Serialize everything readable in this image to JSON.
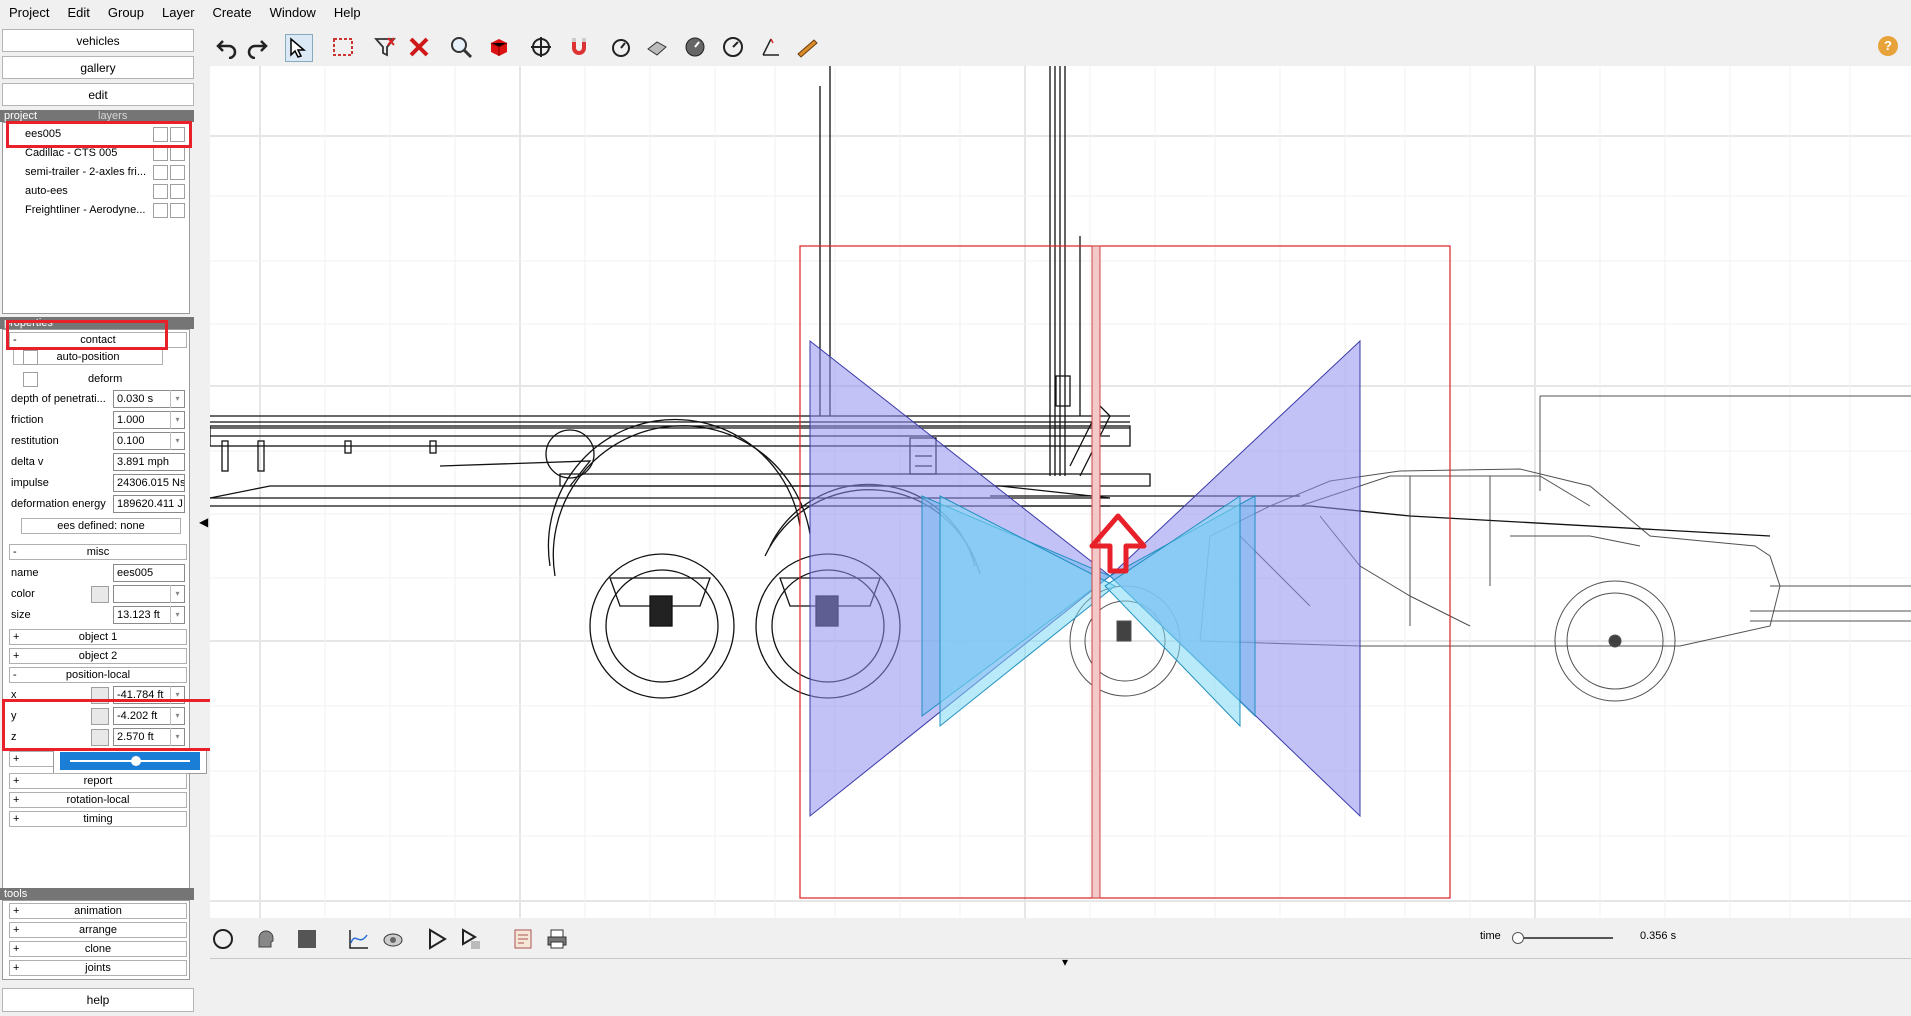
{
  "menu": [
    "Project",
    "Edit",
    "Group",
    "Layer",
    "Create",
    "Window",
    "Help"
  ],
  "nav": {
    "vehicles": "vehicles",
    "gallery": "gallery",
    "edit": "edit"
  },
  "project_panel": {
    "tab_project": "project",
    "tab_layers": "layers",
    "items": [
      "ees005",
      "Cadillac - CTS 005",
      "semi-trailer - 2-axles fri...",
      "auto-ees",
      "Freightliner - Aerodyne..."
    ]
  },
  "properties": {
    "header": "properties",
    "contact": {
      "label": "contact",
      "toggle": "-"
    },
    "auto_position": "auto-position",
    "deform": "deform",
    "fields": [
      {
        "label": "depth of penetrati...",
        "value": "0.030 s"
      },
      {
        "label": "friction",
        "value": "1.000"
      },
      {
        "label": "restitution",
        "value": "0.100"
      },
      {
        "label": "delta v",
        "value": "3.891 mph"
      },
      {
        "label": "impulse",
        "value": "24306.015 Ns"
      },
      {
        "label": "deformation energy",
        "value": "189620.411 J"
      }
    ],
    "ees_defined": "ees defined: none",
    "misc": {
      "label": "misc",
      "toggle": "-"
    },
    "misc_fields": [
      {
        "label": "name",
        "value": "ees005"
      },
      {
        "label": "color",
        "value": ""
      },
      {
        "label": "size",
        "value": "13.123 ft"
      }
    ],
    "object1": {
      "label": "object 1",
      "toggle": "+"
    },
    "object2": {
      "label": "object 2",
      "toggle": "+"
    },
    "position_local": {
      "label": "position-local",
      "toggle": "-"
    },
    "pos_fields": [
      {
        "label": "x",
        "value": "-41.784 ft"
      },
      {
        "label": "y",
        "value": "-4.202 ft"
      },
      {
        "label": "z",
        "value": "2.570 ft"
      }
    ],
    "slider_value": 0.55,
    "report": {
      "label": "report",
      "toggle": "+"
    },
    "rotation_local": {
      "label": "rotation-local",
      "toggle": "+"
    },
    "timing": {
      "label": "timing",
      "toggle": "+"
    }
  },
  "tools": {
    "header": "tools",
    "items": [
      {
        "label": "animation",
        "toggle": "+"
      },
      {
        "label": "arrange",
        "toggle": "+"
      },
      {
        "label": "clone",
        "toggle": "+"
      },
      {
        "label": "joints",
        "toggle": "+"
      }
    ]
  },
  "help": "help",
  "help_icon": "?",
  "time": {
    "label": "time",
    "value": "0.356 s",
    "fraction": 0.02
  },
  "colors": {
    "highlight": "#e8202a",
    "ees_plane": "#9a9af0",
    "ees_plane_light": "#8fd8f5",
    "box": "#e02020"
  }
}
